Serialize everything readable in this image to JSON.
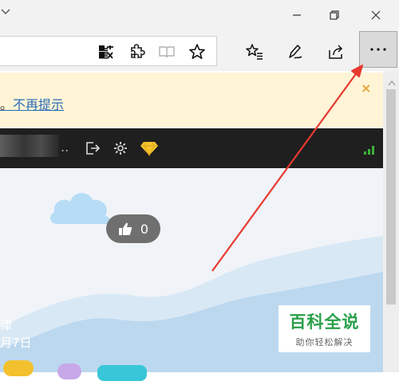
{
  "window": {
    "controls": [
      "minimize",
      "restore",
      "close"
    ]
  },
  "toolbar": {
    "more_label": "···",
    "icons": [
      "translate-icon",
      "extension-icon",
      "reading-view-icon",
      "favorite-star-icon",
      "favorites-hub-icon",
      "pen-notes-icon",
      "share-icon",
      "more-icon"
    ]
  },
  "notice": {
    "link_text": "不再提示",
    "prefix": "。",
    "close_label": "×"
  },
  "darkbar": {
    "dots": ".."
  },
  "content": {
    "like_count": "0",
    "date_fragment_1": "津",
    "date_fragment_2": "月7日"
  },
  "watermark": {
    "title": "百科全说",
    "subtitle": "助你轻松解决"
  },
  "colors": {
    "notice_bg": "#fff4d6",
    "link": "#2b6cb8",
    "arrow": "#e8392f",
    "brand_green": "#2aa04a"
  }
}
